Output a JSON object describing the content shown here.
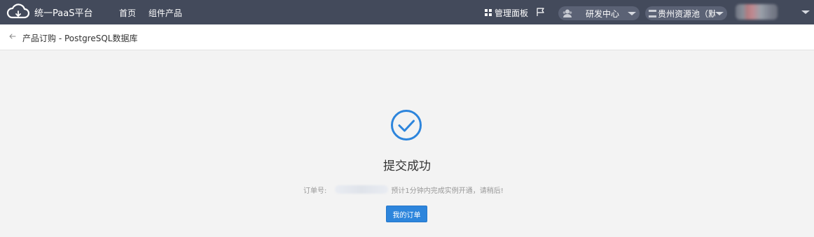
{
  "header": {
    "app_title": "统一PaaS平台",
    "nav": [
      {
        "label": "首页"
      },
      {
        "label": "组件产品"
      }
    ],
    "dashboard_label": "管理面板",
    "department": {
      "label": "研发中心",
      "icon": "user-group-icon"
    },
    "resource_pool": {
      "label": "贵州资源池（默…",
      "icon": "server-icon"
    },
    "user_menu": {
      "icon": "avatar"
    }
  },
  "subheader": {
    "back_icon": "arrow-left-icon",
    "title": "产品订购 - PostgreSQL数据库"
  },
  "result": {
    "icon": "check-circle-icon",
    "title": "提交成功",
    "order_label": "订单号:",
    "message": "预计1分钟内完成实例开通，请稍后!",
    "button_label": "我的订单"
  },
  "colors": {
    "topbar": "#434a5b",
    "accent": "#2d85dc",
    "page_bg": "#f3f3f3"
  }
}
